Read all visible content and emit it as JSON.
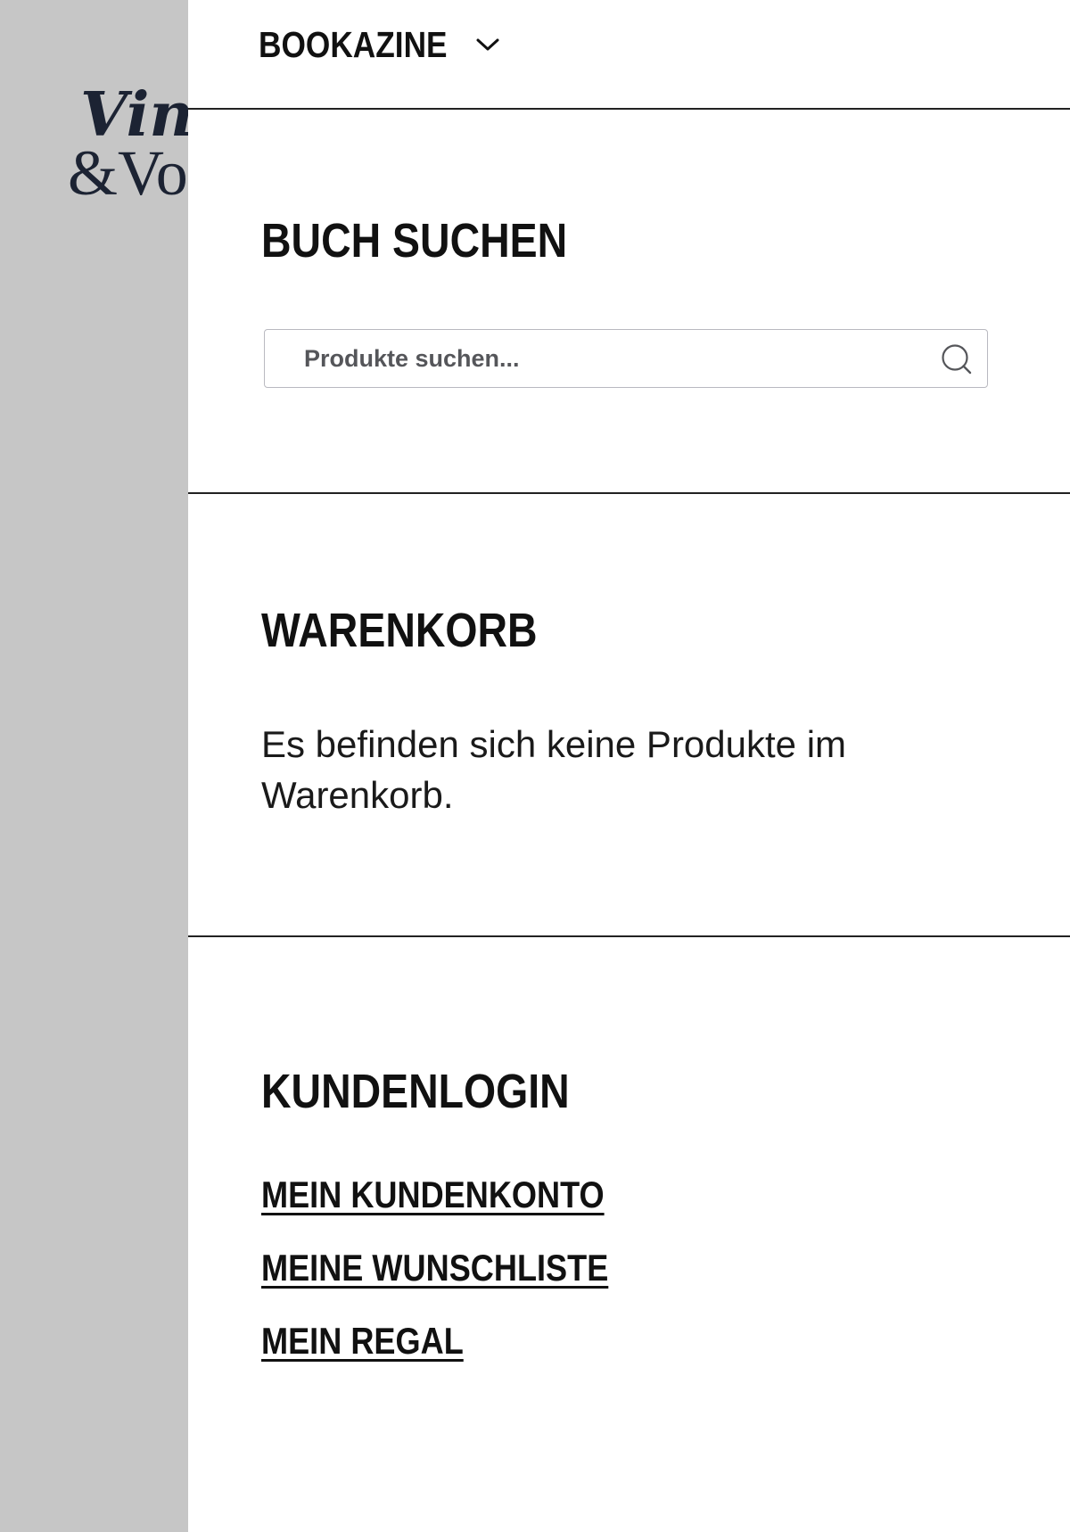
{
  "logo": {
    "line1": "Vinc",
    "line2": "&Vol"
  },
  "menu": {
    "label": "BOOKAZINE",
    "icon": "chevron-down-icon"
  },
  "search_section": {
    "title": "BUCH SUCHEN",
    "placeholder": "Produkte suchen...",
    "value": "",
    "icon": "search-icon"
  },
  "cart_section": {
    "title": "WARENKORB",
    "empty_message": "Es befinden sich keine Produkte im Warenkorb."
  },
  "login_section": {
    "title": "KUNDENLOGIN",
    "links": [
      {
        "label": "MEIN KUNDENKONTO"
      },
      {
        "label": "MEINE WUNSCHLISTE"
      },
      {
        "label": "MEIN REGAL"
      }
    ]
  },
  "colors": {
    "backdrop": "#c6c6c6",
    "panel": "#ffffff",
    "text": "#111111",
    "logo": "#1c2333",
    "input_border": "#b9b9c0"
  }
}
